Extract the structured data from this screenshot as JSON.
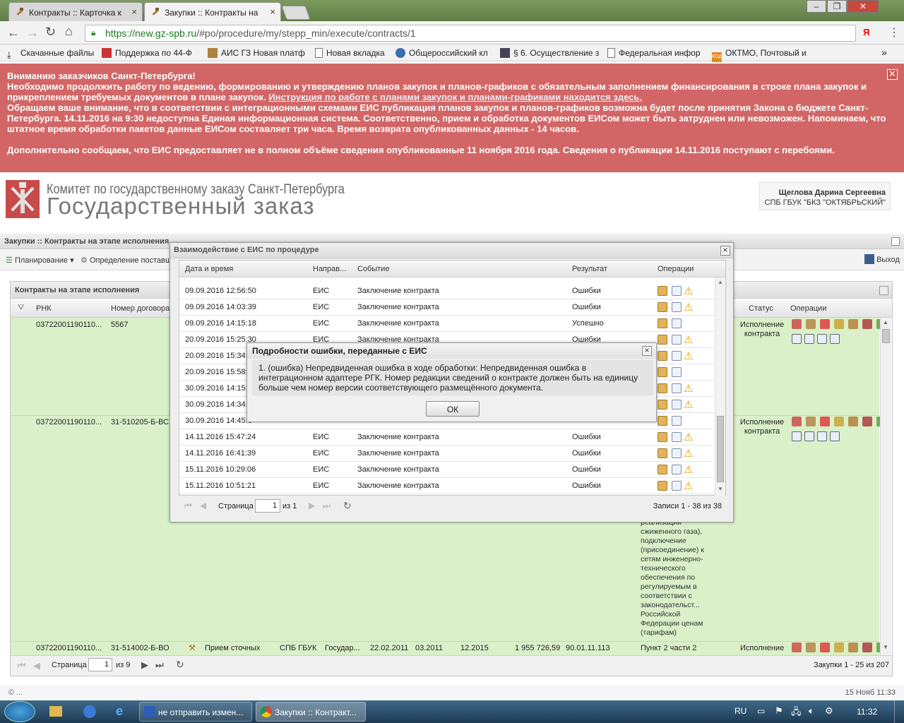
{
  "browser": {
    "tabs": [
      {
        "label": "Контракты :: Карточка к"
      },
      {
        "label": "Закупки :: Контракты на"
      }
    ],
    "url_host": "https://new.gz-spb.ru",
    "url_path": "/#po/procedure/my/stepp_min/execute/contracts/1",
    "profile_letter": "Я",
    "bookmarks": [
      {
        "label": "Скачанные файлы",
        "icon": "download-icon"
      },
      {
        "label": "Поддержка по 44-Ф",
        "icon": "site-icon"
      },
      {
        "label": "АИС ГЗ Новая платф",
        "icon": "hammer-icon"
      },
      {
        "label": "Новая вкладка",
        "icon": "page-icon"
      },
      {
        "label": "Общероссийский кл",
        "icon": "shield-icon"
      },
      {
        "label": "§ 6. Осуществление з",
        "icon": "portrait-icon"
      },
      {
        "label": "Федеральная инфор",
        "icon": "page-icon"
      },
      {
        "label": "ОКТМО, Почтовый и",
        "icon": "kod-icon"
      }
    ],
    "bookmarks_more": "»"
  },
  "banner": {
    "title": "Вниманию заказчиков Санкт-Петербурга!",
    "para1": "Необходимо продолжить работу по ведению, формированию и утверждению планов закупок и планов-графиков с обязательным заполнением финансирования в строке плана закупок и прикреплением требуемых документов в плане закупок.",
    "link": "Инструкция по работе с планами закупок и планами-графиками находится здесь.",
    "para2": "Обращаем ваше внимание, что в соответствии с интеграционными схемами ЕИС публикация планов закупок и планов-графиков возможна будет после принятия Закона о бюджете Санкт-Петербурга. 14.11.2016 на 9:30 недоступна Единая информационная система. Соответственно, прием и обработка документов ЕИСом может быть затруднен или невозможен. Напоминаем, что штатное время обработки пакетов данные ЕИСом составляет три часа. Время возврата опубликованных данных - 14 часов.",
    "para3": "Дополнительно сообщаем, что ЕИС предоставляет не в полном объёме сведения опубликованные 11 ноября 2016 года. Сведения о публикации 14.11.2016 поступают с перебоями."
  },
  "header": {
    "org_line": "Комитет по государственному заказу Санкт-Петербурга",
    "app_title": "Государственный заказ",
    "user_name": "Щеглова Дарина Сергеевна",
    "user_org": "СПБ ГБУК \"БКЗ \"ОКТЯБРЬСКИЙ\""
  },
  "app": {
    "panel_title": "Закупки :: Контракты на этапе исполнения",
    "menu": [
      {
        "label": "Планирование"
      },
      {
        "label": "Определение поставщ"
      }
    ],
    "exit_label": "Выход",
    "grid_title": "Контракты на этапе исполнения",
    "columns": {
      "rnk": "РНК",
      "number": "Номер договора",
      "status": "Статус",
      "ops": "Операции"
    },
    "rows": [
      {
        "rnk": "03722001190110...",
        "number": "5567",
        "status": "Исполнение контракта"
      },
      {
        "rnk": "03722001190110...",
        "number": "31-510205-Б-ВС",
        "status": "Исполнение контракта"
      },
      {
        "rnk": "03722001190110...",
        "number": "31-514002-Б-ВО",
        "subject": "Прием сточных",
        "customer": "СПБ ГБУК",
        "law": "Государ...",
        "date1": "22.02.2011",
        "date2": "03.2011",
        "date3": "12.2015",
        "sum": "1 955 726,59",
        "okpd": "90.01.11.113",
        "basis": "Пункт 2 части 2",
        "status": "Исполнение"
      }
    ],
    "long_text": [
      "реализации",
      "сжиженного газа),",
      "подключение",
      "(присоединение) к",
      "сетям инженерно-",
      "технического",
      "обеспечения по",
      "регулируемым в",
      "соответствии с",
      "законодательст...",
      "Российской",
      "Федерации ценам",
      "(тарифам)"
    ],
    "pager": {
      "page_label": "Страница",
      "page": "1",
      "of": "из 9",
      "summary": "Закупки 1 - 25 из 207"
    },
    "footer_left": "© ...",
    "footer_right": "15 Нояб 11:33"
  },
  "eis_dialog": {
    "title": "Взаимодействие с ЕИС по процедуре",
    "columns": {
      "datetime": "Дата и время",
      "direction": "Направ...",
      "event": "Событие",
      "result": "Результат",
      "ops": "Операции"
    },
    "rows": [
      {
        "datetime": "09.09.2016 12:56:50",
        "direction": "ЕИС",
        "event": "Заключение контракта",
        "result": "Ошибки",
        "warn": true
      },
      {
        "datetime": "09.09.2016 14:03:39",
        "direction": "ЕИС",
        "event": "Заключение контракта",
        "result": "Ошибки",
        "warn": true
      },
      {
        "datetime": "09.09.2016 14:15:18",
        "direction": "ЕИС",
        "event": "Заключение контракта",
        "result": "Успешно",
        "warn": false
      },
      {
        "datetime": "20.09.2016 15:25:30",
        "direction": "ЕИС",
        "event": "Заключение контракта",
        "result": "Ошибки",
        "warn": true
      },
      {
        "datetime": "20.09.2016 15:34:",
        "direction": "",
        "event": "",
        "result": "",
        "warn": true
      },
      {
        "datetime": "20.09.2016 15:58:",
        "direction": "",
        "event": "",
        "result": "",
        "warn": false
      },
      {
        "datetime": "30.09.2016 14:15:",
        "direction": "",
        "event": "",
        "result": "",
        "warn": true
      },
      {
        "datetime": "30.09.2016 14:34:",
        "direction": "",
        "event": "",
        "result": "",
        "warn": true
      },
      {
        "datetime": "30.09.2016 14:45:0",
        "direction": "",
        "event": "",
        "result": "",
        "warn": false
      },
      {
        "datetime": "14.11.2016 15:47:24",
        "direction": "ЕИС",
        "event": "Заключение контракта",
        "result": "Ошибки",
        "warn": true
      },
      {
        "datetime": "14.11.2016 16:41:39",
        "direction": "ЕИС",
        "event": "Заключение контракта",
        "result": "Ошибки",
        "warn": true
      },
      {
        "datetime": "15.11.2016 10:29:06",
        "direction": "ЕИС",
        "event": "Заключение контракта",
        "result": "Ошибки",
        "warn": true
      },
      {
        "datetime": "15.11.2016 10:51:21",
        "direction": "ЕИС",
        "event": "Заключение контракта",
        "result": "Ошибки",
        "warn": true
      }
    ],
    "pager": {
      "page_label": "Страница",
      "page": "1",
      "of": "из 1",
      "summary": "Записи 1 - 38 из 38"
    }
  },
  "error_dialog": {
    "title": "Подробности ошибки, переданные с ЕИС",
    "message": "1. (ошибка) Непредвиденная ошибка в ходе обработки: Непредвиденная ошибка в интеграционном адаптере РГК. Номер редакции сведений о контракте должен быть на единицу больше чем номер версии соответствующего размещённого документа.",
    "ok_label": "ОК"
  },
  "taskbar": {
    "items": [
      {
        "label": "не отправить измен..."
      },
      {
        "label": "Закупки :: Контракт..."
      }
    ],
    "lang": "RU",
    "time": "11:32"
  }
}
